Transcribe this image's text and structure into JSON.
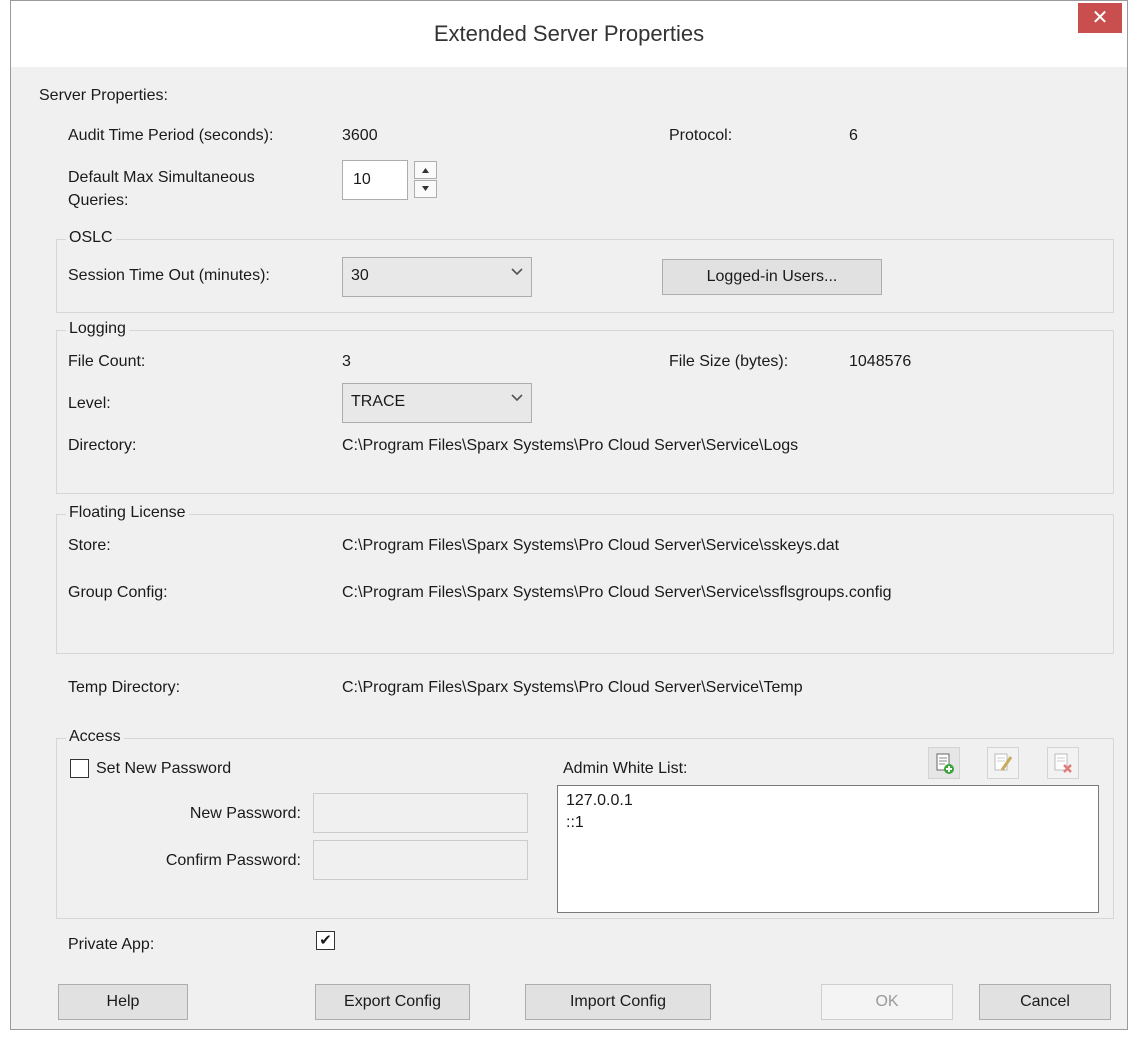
{
  "window": {
    "title": "Extended Server Properties",
    "close_glyph": "✕"
  },
  "server": {
    "heading": "Server Properties:",
    "audit_label": "Audit Time Period (seconds):",
    "audit_value": "3600",
    "protocol_label": "Protocol:",
    "protocol_value": "6",
    "max_queries_label_line1": "Default Max Simultaneous",
    "max_queries_label_line2": "Queries:",
    "max_queries_value": "10"
  },
  "oslc": {
    "label": "OSLC",
    "session_label": "Session Time Out (minutes):",
    "session_value": "30",
    "logged_in_button": "Logged-in Users..."
  },
  "logging": {
    "label": "Logging",
    "file_count_label": "File Count:",
    "file_count_value": "3",
    "file_size_label": "File Size (bytes):",
    "file_size_value": "1048576",
    "level_label": "Level:",
    "level_value": "TRACE",
    "directory_label": "Directory:",
    "directory_value": "C:\\Program Files\\Sparx Systems\\Pro Cloud Server\\Service\\Logs"
  },
  "floating_license": {
    "label": "Floating License",
    "store_label": "Store:",
    "store_value": "C:\\Program Files\\Sparx Systems\\Pro Cloud Server\\Service\\sskeys.dat",
    "group_config_label": "Group Config:",
    "group_config_value": "C:\\Program Files\\Sparx Systems\\Pro Cloud Server\\Service\\ssflsgroups.config"
  },
  "temp": {
    "label": "Temp Directory:",
    "value": "C:\\Program Files\\Sparx Systems\\Pro Cloud Server\\Service\\Temp"
  },
  "access": {
    "label": "Access",
    "set_password_label": "Set New Password",
    "set_password_checked": false,
    "new_password_label": "New Password:",
    "new_password_value": "",
    "confirm_password_label": "Confirm Password:",
    "confirm_password_value": "",
    "white_list_label": "Admin White List:",
    "white_list": [
      "127.0.0.1",
      "::1"
    ]
  },
  "private_app": {
    "label": "Private App:",
    "checked": true,
    "check_glyph": "✔"
  },
  "footer": {
    "help": "Help",
    "export": "Export Config",
    "import": "Import Config",
    "ok": "OK",
    "cancel": "Cancel"
  },
  "colors": {
    "close_bg": "#c94f4f",
    "window_bg": "#f0f0f0",
    "group_border": "#d6d6d6"
  }
}
